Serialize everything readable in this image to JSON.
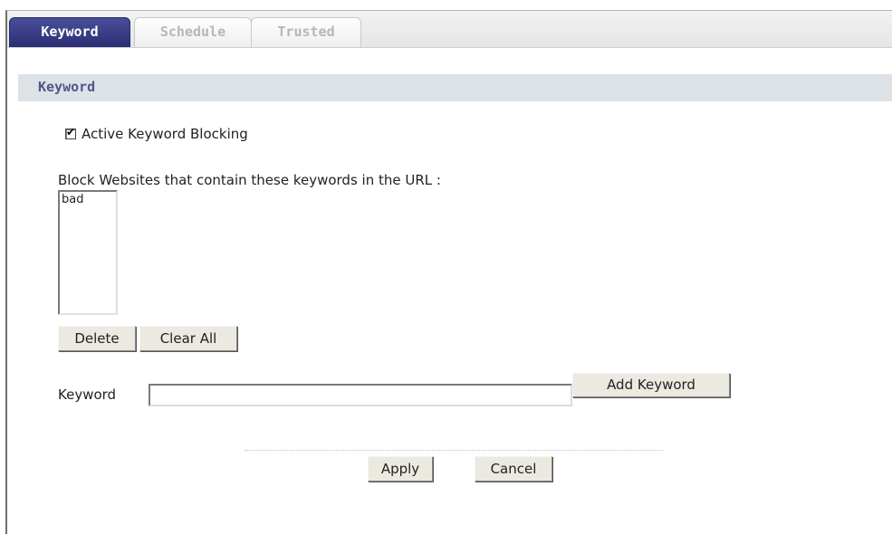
{
  "tabs": [
    {
      "label": "Keyword",
      "active": true
    },
    {
      "label": "Schedule",
      "active": false
    },
    {
      "label": "Trusted",
      "active": false
    }
  ],
  "section": {
    "title": "Keyword"
  },
  "active_blocking": {
    "label": "Active Keyword Blocking",
    "checked": true,
    "mark": "✔"
  },
  "block_list": {
    "label": "Block Websites that contain these keywords in the URL :",
    "items": [
      "bad"
    ]
  },
  "buttons": {
    "delete": "Delete",
    "clear_all": "Clear All",
    "add_keyword": "Add Keyword",
    "apply": "Apply",
    "cancel": "Cancel"
  },
  "keyword_field": {
    "label": "Keyword",
    "value": ""
  },
  "colors": {
    "active_tab": "#2f3379",
    "section_bg": "#dde2e6",
    "section_title": "#51558e"
  }
}
